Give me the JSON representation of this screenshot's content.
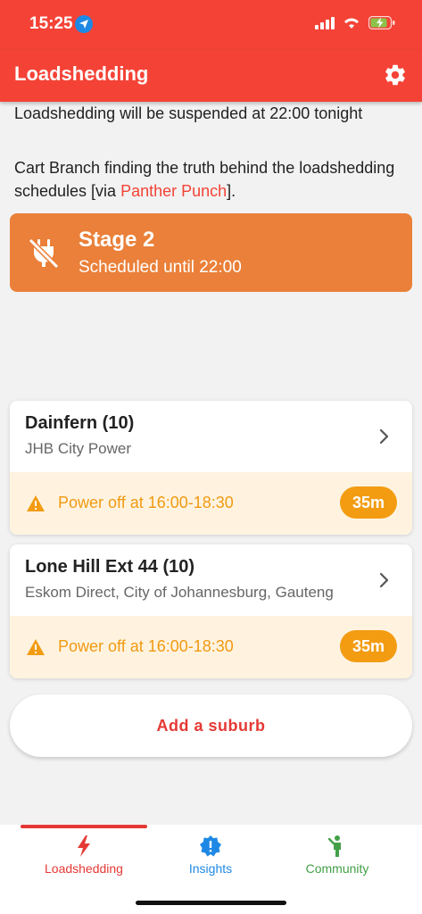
{
  "status_bar": {
    "time": "15:25"
  },
  "app_bar": {
    "title": "Loadshedding"
  },
  "notices": {
    "line1": "Loadshedding will be suspended at 22:00 tonight",
    "line2_prefix": "Cart Branch finding the truth behind the loadshedding schedules [via ",
    "line2_link": "Panther Punch",
    "line2_suffix": "]."
  },
  "stage": {
    "title": "Stage 2",
    "subtitle": "Scheduled until 22:00",
    "color": "#ea8039"
  },
  "suburbs": [
    {
      "name": "Dainfern (10)",
      "provider": "JHB City Power",
      "alert": "Power off at 16:00-18:30",
      "countdown": "35m"
    },
    {
      "name": "Lone Hill Ext 44 (10)",
      "provider": "Eskom Direct, City of Johannesburg, Gauteng",
      "alert": "Power off at 16:00-18:30",
      "countdown": "35m"
    }
  ],
  "add_suburb": {
    "label": "Add a suburb"
  },
  "tabs": [
    {
      "label": "Loadshedding",
      "icon": "lightning-icon",
      "color": "#e53935"
    },
    {
      "label": "Insights",
      "icon": "alert-badge-icon",
      "color": "#1e88e5"
    },
    {
      "label": "Community",
      "icon": "person-icon",
      "color": "#43a047"
    }
  ],
  "colors": {
    "brand": "#f44336",
    "warning": "#f39c12"
  }
}
